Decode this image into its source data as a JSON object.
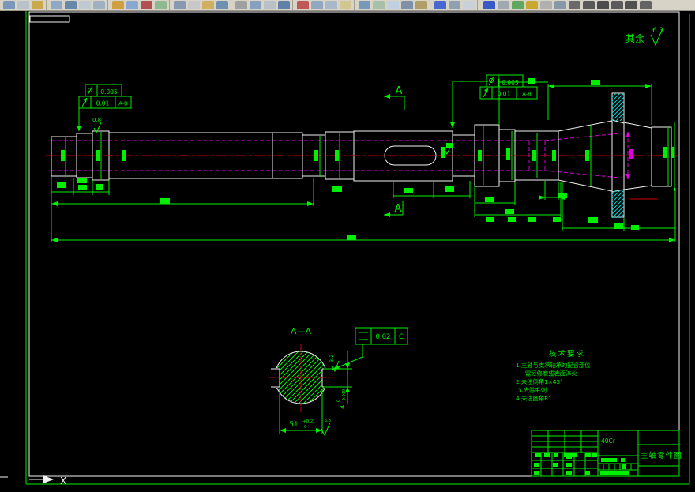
{
  "surface_note": {
    "prefix": "其余",
    "value": "6.3"
  },
  "roughness": {
    "step_mark": "0.8",
    "section_side": "3.2",
    "section_bottom": "6.3"
  },
  "section_marker": {
    "label": "A",
    "label2": "A",
    "view_title": "A—A"
  },
  "gdt_left": {
    "row1_value": "0.005",
    "row2_value": "0.01",
    "row2_datum": "A-B"
  },
  "gdt_right": {
    "row1_value": "0.005",
    "row2_value": "0.01",
    "row2_datum": "A-B"
  },
  "gdt_section": {
    "value": "0.02",
    "datum": "C"
  },
  "dims": {
    "across_flats": "51",
    "across_flats_tol_upper": "+0.2",
    "across_flats_tol_lower": "0",
    "key_width": "14",
    "key_width_tol_upper": "0",
    "key_width_tol_lower": "-0.019"
  },
  "tech_req": {
    "title": "技术要求",
    "lines": [
      "1.主轴与支承轴承的配合部位",
      "需经修磨或表面淬火",
      "2.未注倒角1×45°",
      "3.去除毛刺",
      "4.未注圆角R1"
    ]
  },
  "title_block": {
    "material": "40Cr",
    "drawing_title": "主轴零件图"
  },
  "ucs": {
    "x_label": "X"
  }
}
